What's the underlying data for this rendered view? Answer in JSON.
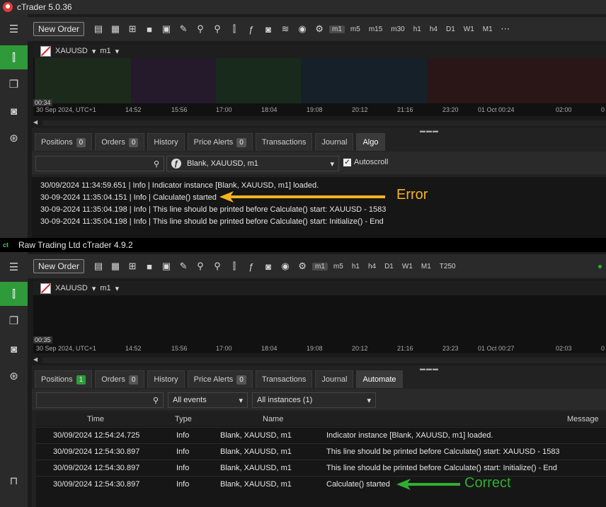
{
  "top": {
    "title": "cTrader 5.0.36",
    "toolbar": {
      "new_order": "New Order",
      "timeframes": [
        "m1",
        "m5",
        "m15",
        "m30",
        "h1",
        "h4",
        "D1",
        "W1",
        "M1"
      ]
    },
    "chart": {
      "symbol": "XAUUSD",
      "period": "m1",
      "price_marker": "00:34",
      "time_labels": [
        "30 Sep 2024, UTC+1",
        "14:52",
        "15:56",
        "17:00",
        "18:04",
        "19:08",
        "20:12",
        "21:16",
        "23:20",
        "01 Oct 00:24",
        "02:00",
        "0"
      ]
    },
    "tabs": [
      {
        "label": "Positions",
        "badge": "0"
      },
      {
        "label": "Orders",
        "badge": "0"
      },
      {
        "label": "History"
      },
      {
        "label": "Price Alerts",
        "badge": "0"
      },
      {
        "label": "Transactions"
      },
      {
        "label": "Journal"
      },
      {
        "label": "Algo"
      }
    ],
    "instance_select": "Blank, XAUUSD, m1",
    "autoscroll": "Autoscroll",
    "log": [
      "30/09/2024 11:34:59.651 | Info | Indicator instance [Blank, XAUUSD, m1] loaded.",
      "30-09-2024 11:35:04.151 | Info | Calculate() started",
      "30-09-2024 11:35:04.198 | Info | This line should be printed before Calculate() start: XAUUSD - 1583",
      "30-09-2024 11:35:04.198 | Info | This line should be printed before Calculate() start: Initialize() - End"
    ],
    "annotation": "Error"
  },
  "bottom": {
    "title": "Raw Trading Ltd cTrader 4.9.2",
    "toolbar": {
      "new_order": "New Order",
      "timeframes": [
        "m1",
        "m5",
        "h1",
        "h4",
        "D1",
        "W1",
        "M1",
        "T250"
      ]
    },
    "chart": {
      "symbol": "XAUUSD",
      "period": "m1",
      "price_marker": "00:35",
      "time_labels": [
        "30 Sep 2024, UTC+1",
        "14:52",
        "15:56",
        "17:00",
        "18:04",
        "19:08",
        "20:12",
        "21:16",
        "23:23",
        "01 Oct 00:27",
        "02:03",
        "0"
      ]
    },
    "tabs": [
      {
        "label": "Positions",
        "badge": "1"
      },
      {
        "label": "Orders",
        "badge": "0"
      },
      {
        "label": "History"
      },
      {
        "label": "Price Alerts",
        "badge": "0"
      },
      {
        "label": "Transactions"
      },
      {
        "label": "Journal"
      },
      {
        "label": "Automate"
      }
    ],
    "events_select": "All events",
    "instances_select": "All instances (1)",
    "columns": [
      "Time",
      "Type",
      "Name",
      "Message"
    ],
    "rows": [
      {
        "time": "30/09/2024 12:54:24.725",
        "type": "Info",
        "name": "Blank, XAUUSD, m1",
        "message": "Indicator instance [Blank, XAUUSD, m1] loaded."
      },
      {
        "time": "30/09/2024 12:54:30.897",
        "type": "Info",
        "name": "Blank, XAUUSD, m1",
        "message": "This line should be printed before Calculate() start: XAUUSD - 1583"
      },
      {
        "time": "30/09/2024 12:54:30.897",
        "type": "Info",
        "name": "Blank, XAUUSD, m1",
        "message": "This line should be printed before Calculate() start: Initialize() - End"
      },
      {
        "time": "30/09/2024 12:54:30.897",
        "type": "Info",
        "name": "Blank, XAUUSD, m1",
        "message": "Calculate() started"
      }
    ],
    "annotation": "Correct"
  },
  "colors": {
    "error": "#f5b324",
    "correct": "#2fae2f",
    "active_green": "#2f9a3a"
  }
}
